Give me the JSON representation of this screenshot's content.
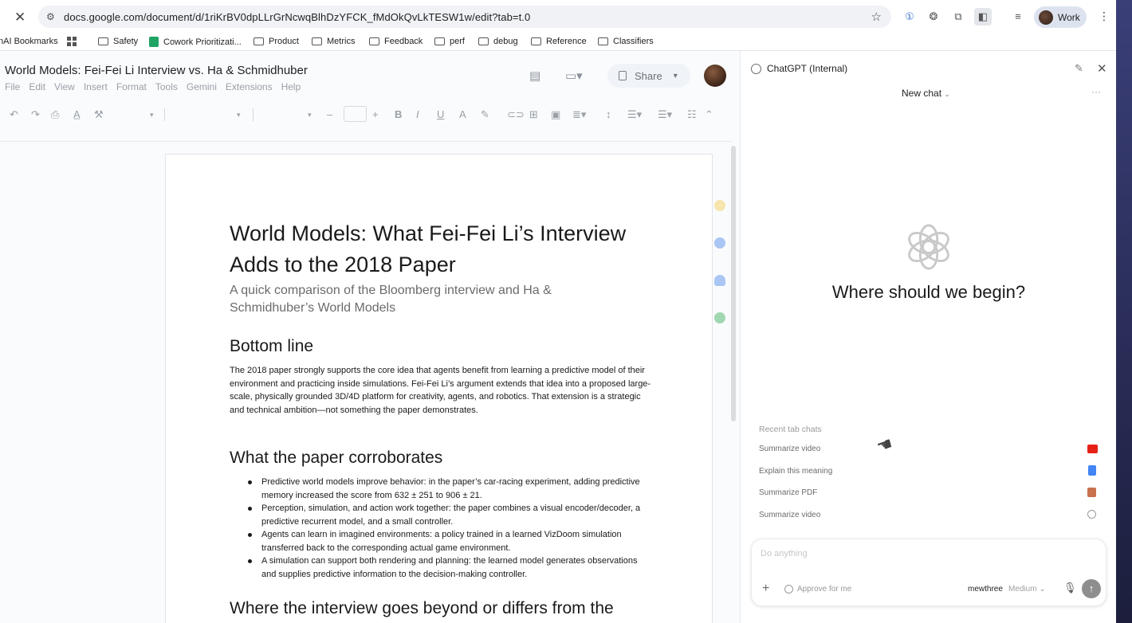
{
  "browser": {
    "url": "docs.google.com/document/d/1riKrBV0dpLLrGrNcwqBlhDzYFCK_fMdOkQvLkTESW1w/edit?tab=t.0",
    "profile_label": "Work"
  },
  "bookmarks": [
    {
      "label": "nAI Bookmarks"
    },
    {
      "label": "Safety"
    },
    {
      "label": "Cowork Prioritizati..."
    },
    {
      "label": "Product"
    },
    {
      "label": "Metrics"
    },
    {
      "label": "Feedback"
    },
    {
      "label": "perf"
    },
    {
      "label": "debug"
    },
    {
      "label": "Reference"
    },
    {
      "label": "Classifiers"
    }
  ],
  "docs": {
    "title": "World Models: Fei-Fei Li Interview vs. Ha & Schmidhuber",
    "menu": [
      "File",
      "Edit",
      "View",
      "Insert",
      "Format",
      "Tools",
      "Gemini",
      "Extensions",
      "Help"
    ],
    "share_label": "Share",
    "doc_heading": "World Models: What Fei-Fei Li’s Interview Adds to the 2018 Paper",
    "doc_subtitle": "A quick comparison of the Bloomberg interview and Ha & Schmidhuber’s World Models",
    "section1_heading": "Bottom line",
    "section1_body": "The 2018 paper strongly supports the core idea that agents benefit from learning a predictive model of their environment and practicing inside simulations. Fei-Fei Li’s argument extends that idea into a proposed large-scale, physically grounded 3D/4D platform for creativity, agents, and robotics. That extension is a strategic and technical ambition—not something the paper demonstrates.",
    "section2_heading": "What the paper corroborates",
    "section2_bullets": [
      "Predictive world models improve behavior: in the paper’s car-racing experiment, adding predictive memory increased the score from 632 ± 251 to 906 ± 21.",
      "Perception, simulation, and action work together: the paper combines a visual encoder/decoder, a predictive recurrent model, and a small controller.",
      "Agents can learn in imagined environments: a policy trained in a learned VizDoom simulation transferred back to the corresponding actual game environment.",
      "A simulation can support both rendering and planning: the learned model generates observations and supplies predictive information to the decision-making controller."
    ],
    "section3_heading": "Where the interview goes beyond or differs from the"
  },
  "chatgpt": {
    "panel_title": "ChatGPT (Internal)",
    "new_chat_label": "New chat",
    "more_label": "···",
    "greeting": "Where should we begin?",
    "recent_label": "Recent tab chats",
    "recent_items": [
      {
        "label": "Summarize video",
        "icon": "youtube-icon",
        "color": "#e62117"
      },
      {
        "label": "Explain this meaning",
        "icon": "docs-icon",
        "color": "#4285f4"
      },
      {
        "label": "Summarize PDF",
        "icon": "pdf-icon",
        "color": "#c9704f"
      },
      {
        "label": "Summarize video",
        "icon": "globe-icon",
        "color": "#9a9a9a"
      }
    ],
    "composer_placeholder": "Do anything",
    "approve_label": "Approve for me",
    "model_name": "mewthree",
    "model_effort": "Medium"
  }
}
